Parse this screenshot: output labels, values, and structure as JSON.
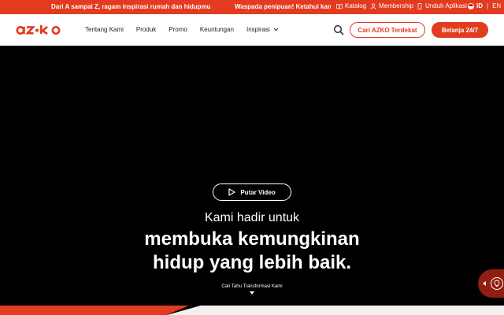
{
  "topbar": {
    "promo_left": "Dari A sampai Z, ragam inspirasi rumah dan hidupmu",
    "promo_right": "Waspada penipuan! Ketahui kanal resmi",
    "catalog": "Katalog",
    "membership": "Membership",
    "app_download": "Unduh Aplikasi",
    "lang_id": "ID",
    "lang_sep": "|",
    "lang_en": "EN"
  },
  "header": {
    "logo_text": "az•ko",
    "nav": {
      "about": "Tentang Kami",
      "products": "Produk",
      "promo": "Promo",
      "benefits": "Keuntungan",
      "inspiration": "Inspirasi"
    },
    "find_store": "Cari AZKO Terdekat",
    "shop": "Belanja 24/7"
  },
  "hero": {
    "play_label": "Putar Video",
    "line1": "Kami hadir untuk",
    "line2": "membuka kemungkinan",
    "line3": "hidup yang lebih baik.",
    "scroll_cta": "Cari Tahu Transformasi Kami"
  },
  "colors": {
    "brand": "#e23b1f",
    "dark_brand": "#8f1f12",
    "hero_bg": "#000000"
  }
}
